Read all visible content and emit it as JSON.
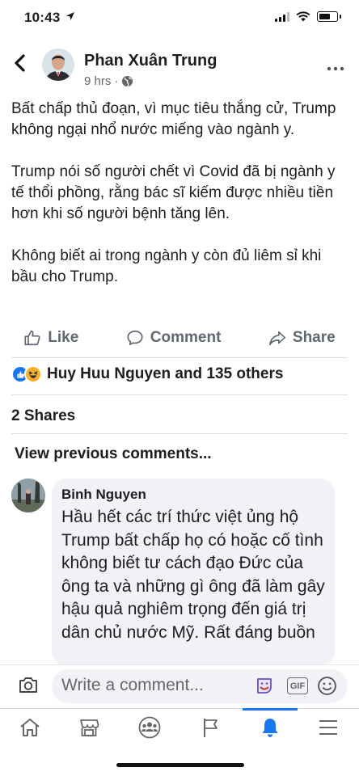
{
  "status_bar": {
    "time": "10:43"
  },
  "header": {
    "author": "Phan Xuân Trung",
    "time_ago": "9 hrs",
    "separator": "·"
  },
  "post": {
    "paragraphs": [
      "Bất chấp thủ đoạn, vì mục tiêu thắng cử, Trump không ngại nhổ nước miếng vào ngành y.",
      "Trump nói số người chết vì Covid đã bị ngành y tế thổi phồng, rằng bác sĩ kiếm được nhiều tiền hơn khi số người bệnh tăng lên.",
      "Không biết ai trong ngành y còn đủ liêm sỉ khi bầu cho Trump."
    ]
  },
  "actions": {
    "like": "Like",
    "comment": "Comment",
    "share": "Share"
  },
  "reactions": {
    "summary": "Huy Huu Nguyen and 135 others"
  },
  "shares": "2 Shares",
  "view_previous": "View previous comments...",
  "comment": {
    "author": "Binh Nguyen",
    "text": "Hầu hết các trí thức việt ủng hộ Trump bất chấp họ có hoặc cố tình không biết tư cách đạo Đức của ông ta và những gì ông đã làm gây hậu quả nghiêm trọng đến giá trị dân chủ nước Mỹ. Rất đáng buồn"
  },
  "composer": {
    "placeholder": "Write a comment...",
    "gif_label": "GIF"
  },
  "tabs": [
    "home",
    "marketplace",
    "groups",
    "pages",
    "notifications",
    "menu"
  ],
  "colors": {
    "accent": "#1877f2",
    "secondary_text": "#65676b",
    "bubble": "#f0f2f5"
  }
}
